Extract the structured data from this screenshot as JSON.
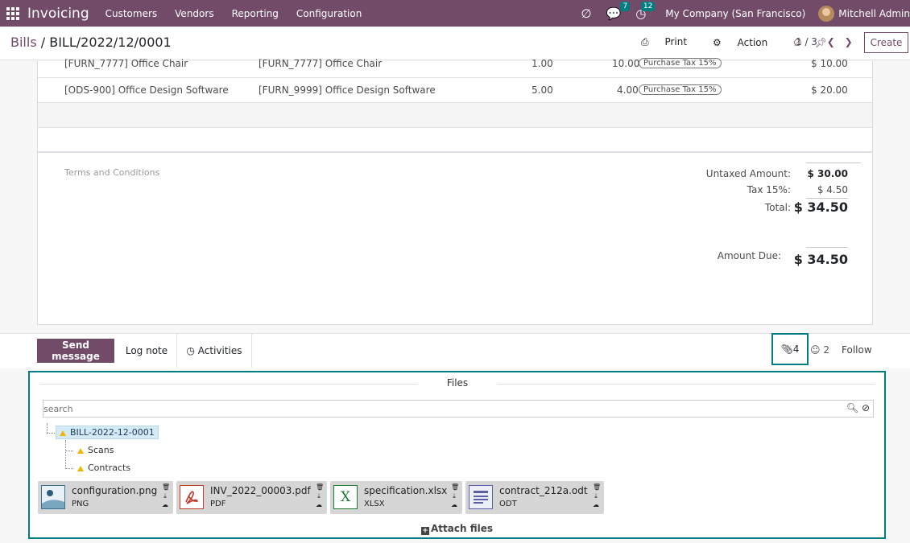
{
  "navbar": {
    "app_name": "Invoicing",
    "menus": [
      "Customers",
      "Vendors",
      "Reporting",
      "Configuration"
    ],
    "messages_badge": "7",
    "activities_badge": "12",
    "company": "My Company (San Francisco)",
    "user": "Mitchell Admin"
  },
  "control_panel": {
    "breadcrumb_parent": "Bills",
    "breadcrumb_current": "BILL/2022/12/0001",
    "print_label": "Print",
    "action_label": "Action",
    "pager": "1 / 3",
    "create_label": "Create"
  },
  "invoice_lines": [
    {
      "product": "[FURN_7777] Office Chair",
      "label": "[FURN_7777] Office Chair",
      "quantity": "1.00",
      "price": "10.00",
      "tax": "Purchase Tax 15%",
      "subtotal": "$ 10.00"
    },
    {
      "product": "[ODS-900] Office Design Software",
      "label": "[FURN_9999] Office Design Software",
      "quantity": "5.00",
      "price": "4.00",
      "tax": "Purchase Tax 15%",
      "subtotal": "$ 20.00"
    }
  ],
  "terms_placeholder": "Terms and Conditions",
  "totals": {
    "untaxed_label": "Untaxed Amount:",
    "untaxed_value": "$ 30.00",
    "tax_label": "Tax 15%:",
    "tax_value": "$ 4.50",
    "total_label": "Total:",
    "total_value": "$ 34.50",
    "due_label": "Amount Due:",
    "due_value": "$ 34.50"
  },
  "chatter": {
    "send_message": "Send message",
    "log_note": "Log note",
    "activities": "Activities",
    "attachment_count": "4",
    "follower_count": "2",
    "follow": "Follow"
  },
  "files": {
    "title": "Files",
    "search_placeholder": "search",
    "root_folder": "BILL-2022-12-0001",
    "subfolders": [
      "Scans",
      "Contracts"
    ],
    "items": [
      {
        "name": "configuration.png",
        "type": "PNG",
        "icon": "image-icon"
      },
      {
        "name": "INV_2022_00003.pdf",
        "type": "PDF",
        "icon": "pdf-icon"
      },
      {
        "name": "specification.xlsx",
        "type": "XLSX",
        "icon": "excel-icon"
      },
      {
        "name": "contract_212a.odt",
        "type": "ODT",
        "icon": "document-icon"
      }
    ],
    "attach_label": "Attach files"
  },
  "colors": {
    "brand": "#714b67",
    "accent": "#017e84"
  }
}
